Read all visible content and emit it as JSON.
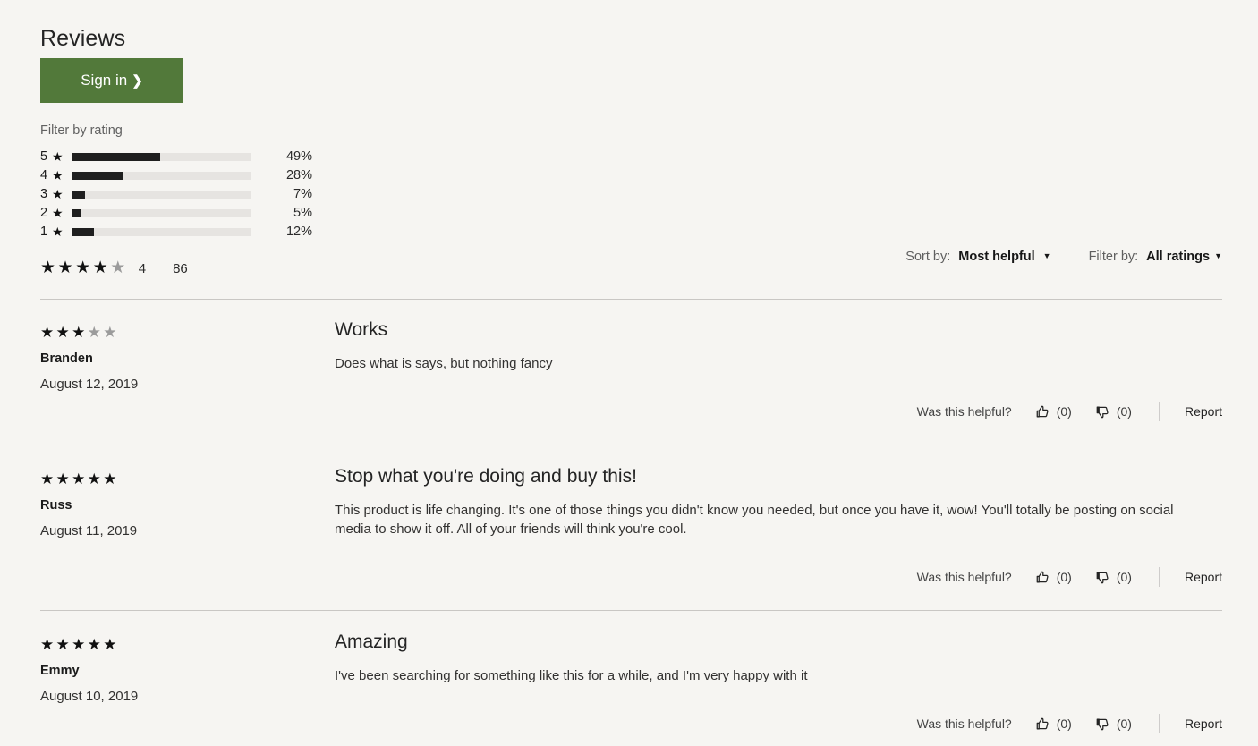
{
  "header": {
    "title": "Reviews",
    "signin_label": "Sign in",
    "signin_chevron": "chevron-right-icon"
  },
  "rating_filter": {
    "label": "Filter by rating",
    "rows": [
      {
        "stars": "5",
        "star_glyph": "★",
        "percent": "49%",
        "value": 49
      },
      {
        "stars": "4",
        "star_glyph": "★",
        "percent": "28%",
        "value": 28
      },
      {
        "stars": "3",
        "star_glyph": "★",
        "percent": "7%",
        "value": 7
      },
      {
        "stars": "2",
        "star_glyph": "★",
        "percent": "5%",
        "value": 5
      },
      {
        "stars": "1",
        "star_glyph": "★",
        "percent": "12%",
        "value": 12
      }
    ]
  },
  "aggregate": {
    "filled_stars": 4,
    "total_stars": 5,
    "rating_value": "4",
    "review_count": "86"
  },
  "controls": {
    "sort": {
      "label": "Sort by:",
      "value": "Most helpful",
      "caret": "chevron-down-icon"
    },
    "filter": {
      "label": "Filter by:",
      "value": "All ratings",
      "caret": "chevron-down-icon"
    }
  },
  "helpful_row": {
    "question": "Was this helpful?",
    "thumbs_up_count": "(0)",
    "thumbs_down_count": "(0)",
    "report_label": "Report"
  },
  "reviews": [
    {
      "filled_stars": 3,
      "total_stars": 5,
      "author": "Branden",
      "date": "August 12, 2019",
      "title": "Works",
      "body": "Does what is says, but nothing fancy",
      "helpful_question": "Was this helpful?",
      "up": "(0)",
      "down": "(0)",
      "report": "Report"
    },
    {
      "filled_stars": 5,
      "total_stars": 5,
      "author": "Russ",
      "date": "August 11, 2019",
      "title": "Stop what you're doing and buy this!",
      "body": "This product is life changing. It's one of those things you didn't know you needed, but once you have it, wow! You'll totally be posting on social media to show it off. All of your friends will think you're cool.",
      "helpful_question": "Was this helpful?",
      "up": "(0)",
      "down": "(0)",
      "report": "Report"
    },
    {
      "filled_stars": 5,
      "total_stars": 5,
      "author": "Emmy",
      "date": "August 10, 2019",
      "title": "Amazing",
      "body": "I've been searching for something like this for a while, and I'm very happy with it",
      "helpful_question": "Was this helpful?",
      "up": "(0)",
      "down": "(0)",
      "report": "Report"
    }
  ],
  "colors": {
    "page_background": "#f6f5f2",
    "signin_button": "#52793a",
    "bar_fill": "#1f1f1f",
    "bar_track": "#e6e4e1",
    "divider": "#c9c7c4",
    "star_on": "#111111",
    "star_off": "#9b9b9b"
  }
}
